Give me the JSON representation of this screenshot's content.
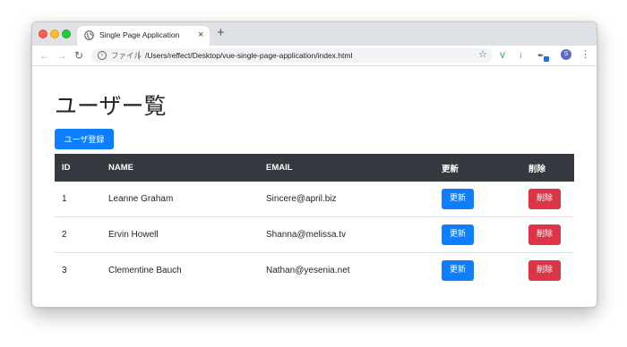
{
  "browser": {
    "tab_title": "Single Page Application",
    "tab_close": "×",
    "new_tab": "+",
    "url_scheme": "ファイル",
    "url": "/Users/reffect/Desktop/vue-single-page-application/index.html",
    "profile_initial": "S",
    "icons": [
      "back-icon",
      "forward-icon",
      "reload-icon",
      "info-icon",
      "star-icon",
      "vue-devtools-icon",
      "extension-icon",
      "tool-icon",
      "menu-icon"
    ]
  },
  "page": {
    "heading": "ユーザー覧",
    "register_button": "ユーザ登録"
  },
  "table": {
    "headers": [
      "ID",
      "NAME",
      "EMAIL",
      "更新",
      "削除"
    ],
    "rows": [
      {
        "id": "1",
        "name": "Leanne Graham",
        "email": "Sincere@april.biz",
        "update": "更新",
        "delete": "削除"
      },
      {
        "id": "2",
        "name": "Ervin Howell",
        "email": "Shanna@melissa.tv",
        "update": "更新",
        "delete": "削除"
      },
      {
        "id": "3",
        "name": "Clementine Bauch",
        "email": "Nathan@yesenia.net",
        "update": "更新",
        "delete": "削除"
      }
    ]
  },
  "colors": {
    "primary": "#0d7ffe",
    "danger": "#dc3545",
    "table_header": "#343a40"
  }
}
